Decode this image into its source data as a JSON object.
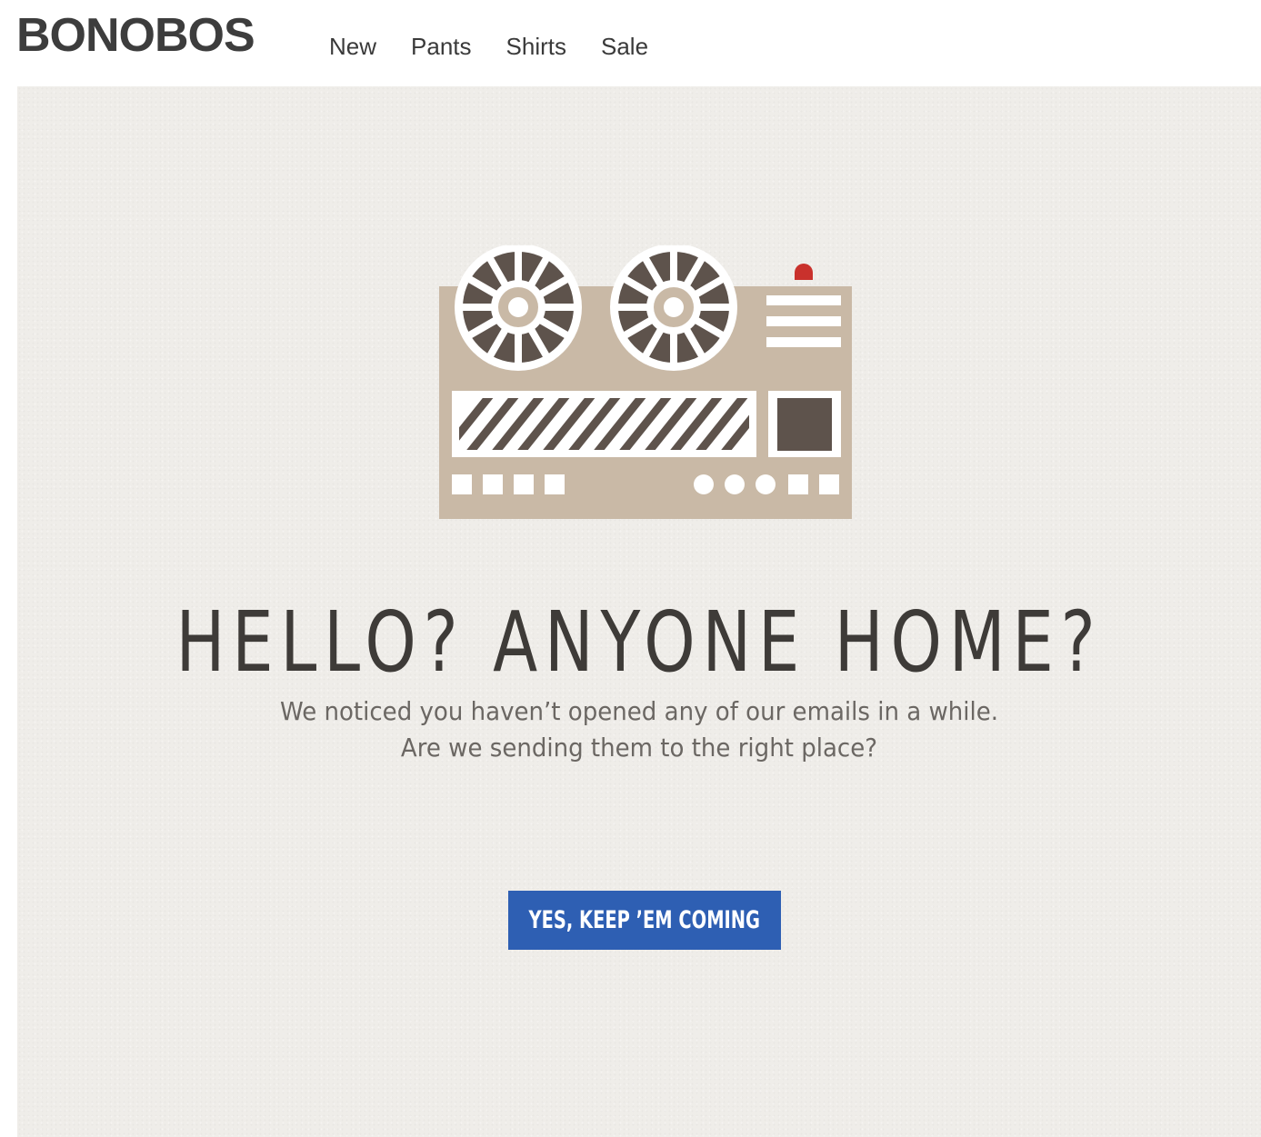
{
  "header": {
    "logo": "BONOBOS",
    "nav": [
      {
        "label": "New"
      },
      {
        "label": "Pants"
      },
      {
        "label": "Shirts"
      },
      {
        "label": "Sale"
      }
    ]
  },
  "hero": {
    "illustration_icon": "reel-to-reel-tape-recorder-icon",
    "headline": "HELLO? ANYONE HOME?",
    "subtext_line1": "We noticed you haven’t opened any of our emails in a while.",
    "subtext_line2": "Are we sending them to the right place?",
    "cta_label": "YES, KEEP ’EM COMING"
  },
  "colors": {
    "background": "#efede9",
    "illustration_tan": "#c9b9a6",
    "illustration_dark": "#5e534c",
    "indicator_red": "#c9312c",
    "cta_blue": "#2e5fb3",
    "text_dark": "#3e3b38"
  }
}
